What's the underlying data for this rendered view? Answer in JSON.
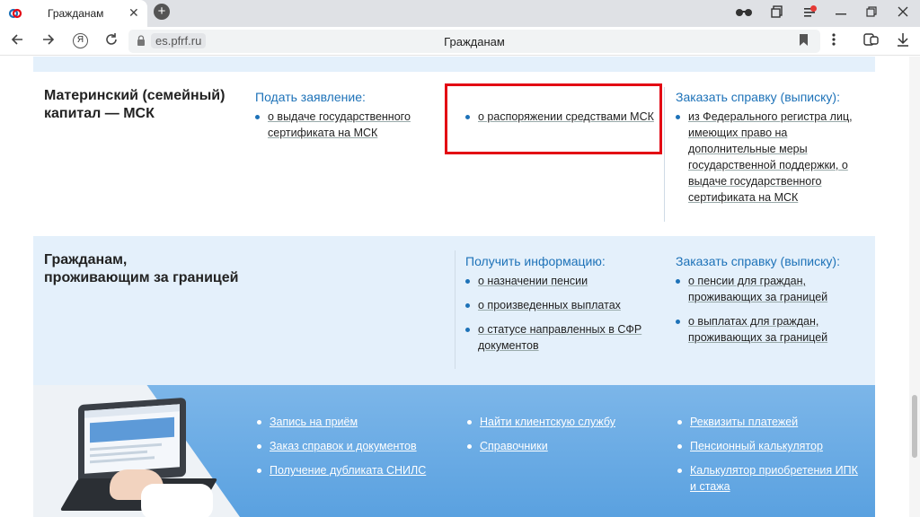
{
  "browser": {
    "tab_title": "Гражданам",
    "tab_close": "✕",
    "new_tab": "+",
    "url_domain": "es.pfrf.ru",
    "page_title": "Гражданам"
  },
  "section_msk": {
    "title_line1": "Материнский (семейный)",
    "title_line2": "капитал — МСК",
    "apply": {
      "title": "Подать заявление:",
      "items": [
        "о выдаче государственного сертификата на МСК"
      ]
    },
    "middle": {
      "items": [
        "о распоряжении средствами МСК"
      ]
    },
    "certificate": {
      "title": "Заказать справку (выписку):",
      "items": [
        "из Федерального регистра лиц, имеющих право на дополнительные меры государственной поддержки, о выдаче государственного сертификата на МСК"
      ]
    }
  },
  "section_abroad": {
    "title_line1": "Гражданам,",
    "title_line2": "проживающим за границей",
    "info": {
      "title": "Получить информацию:",
      "items": [
        "о назначении пенсии",
        "о произведенных выплатах",
        "о статусе направленных в СФР документов"
      ]
    },
    "certificate": {
      "title": "Заказать справку (выписку):",
      "items": [
        "о пенсии для граждан, проживающих за границей",
        "о выплатах для граждан, проживающих за границей"
      ]
    }
  },
  "footer": {
    "col1": [
      "Запись на приём",
      "Заказ справок и документов",
      "Получение дубликата СНИЛС"
    ],
    "col2": [
      "Найти клиентскую службу",
      "Справочники"
    ],
    "col3": [
      "Реквизиты платежей",
      "Пенсионный калькулятор",
      "Калькулятор приобретения ИПК и стажа"
    ]
  },
  "colors": {
    "accent_blue": "#1d72b8",
    "highlight_red": "#e30613",
    "section_bg": "#e4f0fb",
    "footer_blue": "#5aa1e0"
  }
}
